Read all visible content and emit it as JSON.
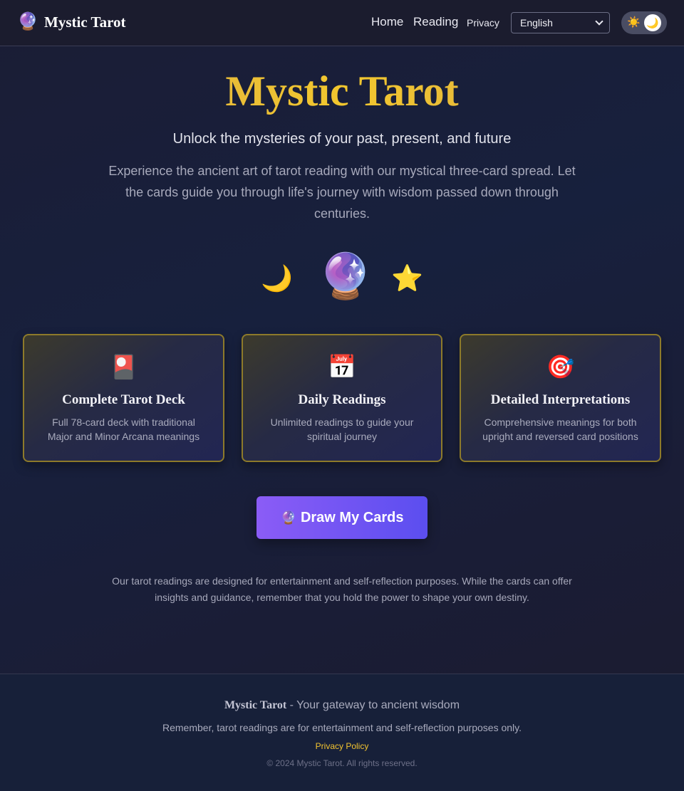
{
  "navbar": {
    "brand_icon": "🔮",
    "brand_name": "Mystic Tarot",
    "links": {
      "home": "Home",
      "reading": "Reading",
      "privacy": "Privacy"
    },
    "language": {
      "selected": "English",
      "icon": "chevron-down-icon"
    },
    "theme_toggle": {
      "sun_icon": "☀️",
      "moon_icon": "🌙",
      "state": "dark"
    }
  },
  "hero": {
    "title": "Mystic Tarot",
    "subtitle": "Unlock the mysteries of your past, present, and future",
    "description": "Experience the ancient art of tarot reading with our mystical three-card spread. Let the cards guide you through life's journey with wisdom passed down through centuries.",
    "icons": {
      "moon": "🌙",
      "crystal_ball": "🔮",
      "star": "⭐"
    }
  },
  "features": [
    {
      "icon": "🎴",
      "title": "Complete Tarot Deck",
      "description": "Full 78-card deck with traditional Major and Minor Arcana meanings"
    },
    {
      "icon": "📅",
      "title": "Daily Readings",
      "description": "Unlimited readings to guide your spiritual journey"
    },
    {
      "icon": "🎯",
      "title": "Detailed Interpretations",
      "description": "Comprehensive meanings for both upright and reversed card positions"
    }
  ],
  "cta": {
    "icon": "🔮",
    "label": "Draw My Cards"
  },
  "disclaimer": "Our tarot readings are designed for entertainment and self-reflection purposes. While the cards can offer insights and guidance, remember that you hold the power to shape your own destiny.",
  "footer": {
    "brand": "Mystic Tarot",
    "tagline": " - Your gateway to ancient wisdom",
    "note": "Remember, tarot readings are for entertainment and self-reflection purposes only.",
    "privacy_link": "Privacy Policy",
    "copyright": "© 2024 Mystic Tarot. All rights reserved."
  },
  "colors": {
    "accent_gold": "#f2c72e",
    "button_start": "#8b5cf6",
    "button_end": "#5b4ef0",
    "card_border": "#8d7a2a",
    "background": "#17203d"
  }
}
